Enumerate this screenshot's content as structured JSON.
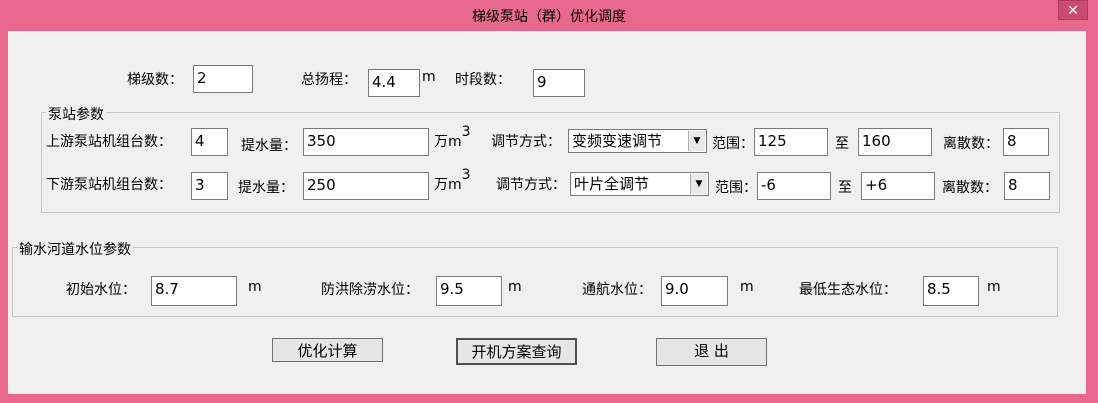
{
  "window": {
    "title": "梯级泵站（群）优化调度",
    "close_label": "✕"
  },
  "top": {
    "cascade_label": "梯级数：",
    "cascade_value": "2",
    "total_head_label": "总扬程：",
    "total_head_value": "4.4",
    "total_head_unit": "m",
    "periods_label": "时段数：",
    "periods_value": "9"
  },
  "pump_group": {
    "title": "泵站参数",
    "upstream": {
      "units_label": "上游泵站机组台数：",
      "units_value": "4",
      "lift_label": "提水量：",
      "lift_value": "350",
      "unit_main": "万m",
      "unit_sup": "3",
      "mode_label": "调节方式：",
      "mode_value": "变频变速调节",
      "range_label": "范围：",
      "range_from": "125",
      "to_label": "至",
      "range_to": "160",
      "discrete_label": "离散数：",
      "discrete_value": "8"
    },
    "downstream": {
      "units_label": "下游泵站机组台数：",
      "units_value": "3",
      "lift_label": "提水量：",
      "lift_value": "250",
      "unit_main": "万m",
      "unit_sup": "3",
      "mode_label": "调节方式：",
      "mode_value": "叶片全调节",
      "range_label": "范围：",
      "range_from": "-6",
      "to_label": "至",
      "range_to": "+6",
      "discrete_label": "离散数：",
      "discrete_value": "8"
    }
  },
  "water_group": {
    "title": "输水河道水位参数",
    "initial_label": "初始水位：",
    "initial_value": "8.7",
    "flood_label": "防洪除涝水位：",
    "flood_value": "9.5",
    "nav_label": "通航水位：",
    "nav_value": "9.0",
    "eco_label": "最低生态水位：",
    "eco_value": "8.5",
    "unit": "m"
  },
  "buttons": {
    "optimize": "优化计算",
    "query": "开机方案查询",
    "exit": "退  出"
  }
}
